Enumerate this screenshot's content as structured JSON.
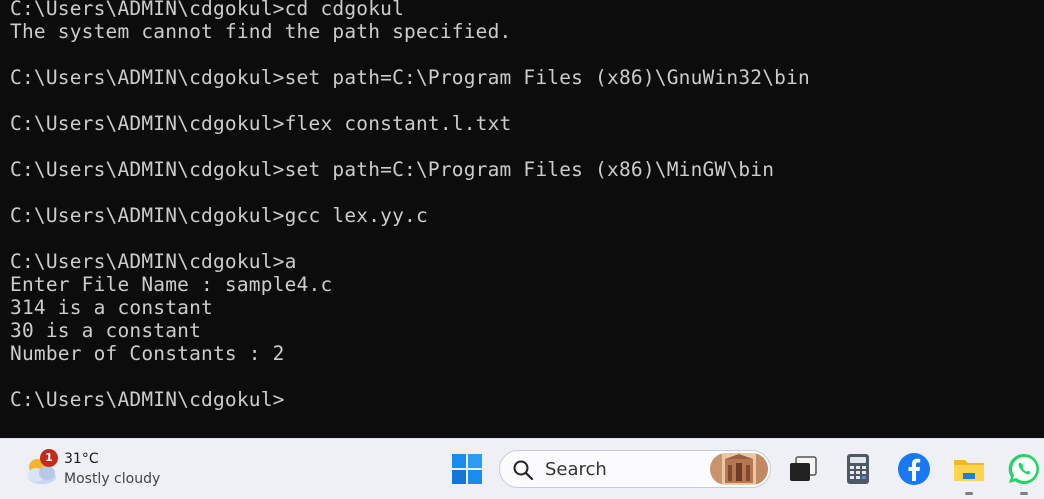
{
  "terminal": {
    "lines": [
      "C:\\Users\\ADMIN\\cdgokul>cd cdgokul",
      "The system cannot find the path specified.",
      "",
      "C:\\Users\\ADMIN\\cdgokul>set path=C:\\Program Files (x86)\\GnuWin32\\bin",
      "",
      "C:\\Users\\ADMIN\\cdgokul>flex constant.l.txt",
      "",
      "C:\\Users\\ADMIN\\cdgokul>set path=C:\\Program Files (x86)\\MinGW\\bin",
      "",
      "C:\\Users\\ADMIN\\cdgokul>gcc lex.yy.c",
      "",
      "C:\\Users\\ADMIN\\cdgokul>a",
      "Enter File Name : sample4.c",
      "314 is a constant",
      "30 is a constant",
      "Number of Constants : 2",
      "",
      "C:\\Users\\ADMIN\\cdgokul>"
    ]
  },
  "taskbar": {
    "weather": {
      "icon": "partly-cloudy-icon",
      "badge_count": "1",
      "temperature": "31°C",
      "condition": "Mostly cloudy"
    },
    "search": {
      "label": "Search"
    },
    "apps": [
      {
        "name": "start-button"
      },
      {
        "name": "task-view"
      },
      {
        "name": "calculator"
      },
      {
        "name": "facebook"
      },
      {
        "name": "file-explorer"
      },
      {
        "name": "whatsapp"
      }
    ]
  },
  "colors": {
    "terminal_bg": "#0c0c0c",
    "terminal_fg": "#cccccc",
    "taskbar_bg": "#eef0f6",
    "windows_blue": "#1a8cf0",
    "facebook_blue": "#1877f2",
    "whatsapp_green": "#25d366"
  }
}
